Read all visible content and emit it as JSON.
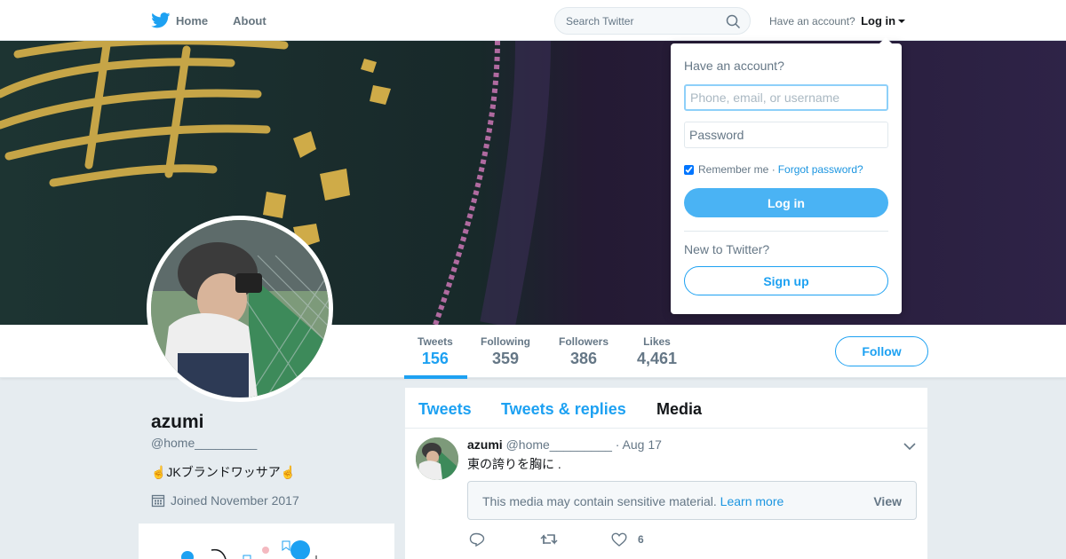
{
  "nav": {
    "home_label": "Home",
    "about_label": "About",
    "search_placeholder": "Search Twitter",
    "have_account": "Have an account?",
    "login_label": "Log in"
  },
  "profile": {
    "name": "azumi",
    "handle": "@home_________",
    "bio": "☝️JKブランドワッサア☝️",
    "joined": "Joined November 2017"
  },
  "stats": [
    {
      "label": "Tweets",
      "value": "156"
    },
    {
      "label": "Following",
      "value": "359"
    },
    {
      "label": "Followers",
      "value": "386"
    },
    {
      "label": "Likes",
      "value": "4,461"
    }
  ],
  "follow_label": "Follow",
  "timeline": {
    "tabs": [
      "Tweets",
      "Tweets & replies",
      "Media"
    ],
    "active_tab": "Media",
    "tweet": {
      "name": "azumi",
      "handle": "@home_________",
      "date": "· Aug 17",
      "text": "東の誇りを胸に .",
      "sensitive_text": "This media may contain sensitive material.",
      "learn_more": "Learn more",
      "view_label": "View",
      "like_count": "6"
    }
  },
  "login_dropdown": {
    "title": "Have an account?",
    "username_placeholder": "Phone, email, or username",
    "password_placeholder": "Password",
    "remember_label": "Remember me ·",
    "forgot_label": "Forgot password?",
    "login_button": "Log in",
    "new_to": "New to Twitter?",
    "signup_button": "Sign up"
  },
  "colors": {
    "accent": "#1da1f2",
    "login_button_bg": "#4ab3f4",
    "background": "#e6ecf0"
  }
}
